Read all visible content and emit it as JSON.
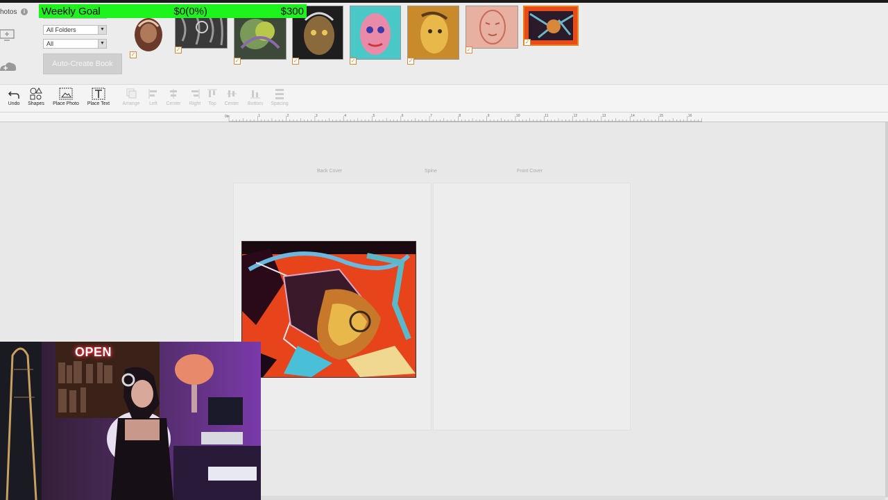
{
  "overlay": {
    "goal_label": "Weekly Goal",
    "goal_progress": "$0(0%)",
    "goal_target": "$300",
    "goal_fraction": 0,
    "open_sign": "OPEN"
  },
  "photo_panel": {
    "label": "hotos",
    "folder_filter": "All Folders",
    "photo_filter": "All",
    "auto_create_label": "Auto-Create Book"
  },
  "toolbar": {
    "undo": "Undo",
    "shapes": "Shapes",
    "place_photo": "Place Photo",
    "place_text": "Place Text",
    "arrange": "Arrange",
    "left": "Left",
    "center": "Center",
    "right": "Right",
    "top": "Top",
    "center_v": "Center",
    "bottom": "Bottom",
    "spacing": "Spacing"
  },
  "ruler": {
    "origin": "0in",
    "ticks": [
      "1",
      "2",
      "3",
      "4",
      "5",
      "6",
      "7",
      "8",
      "9",
      "10",
      "11",
      "12",
      "13",
      "14",
      "15",
      "16"
    ]
  },
  "workspace": {
    "back_cover": "Back Cover",
    "spine": "Spine",
    "front_cover": "Front Cover"
  },
  "colors": {
    "goal_bar": "#1cf41c",
    "selected_accent": "#e8821e",
    "workspace_bg": "#e8e8e8"
  }
}
